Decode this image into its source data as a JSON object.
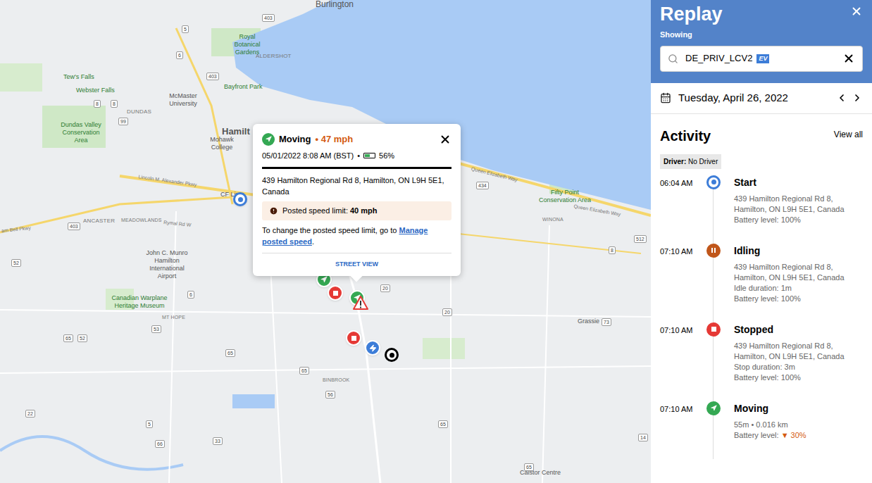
{
  "map": {
    "labels": [
      "Burlington",
      "Royal Botanical Gardens",
      "ALDERSHOT",
      "Tew's Falls",
      "Webster Falls",
      "McMaster University",
      "Bayfront Park",
      "DUNDAS",
      "Dundas Valley Conservation Area",
      "Hamilt",
      "Mohawk College",
      "CF Lime",
      "ANCASTER",
      "MEADOWLANDS",
      "Lincoln M. Alexander Pkwy",
      "Rymal Rd W",
      "am Bell Pkwy",
      "John C. Munro Hamilton International Airport",
      "Canadian Warplane Heritage Museum",
      "MT HOPE",
      "BINBROOK",
      "Fifty Point Conservation Area",
      "WINONA",
      "Queen Elizabeth Way",
      "Queen Elizabeth Way",
      "Grassie",
      "Caistor Centre"
    ],
    "shields": [
      "5",
      "403",
      "6",
      "403",
      "8",
      "8",
      "99",
      "434",
      "512",
      "8",
      "52",
      "6",
      "53",
      "52",
      "65",
      "65",
      "56",
      "65",
      "20",
      "20",
      "73",
      "5",
      "22",
      "33",
      "66",
      "65",
      "14",
      "65",
      "403"
    ],
    "pins": [
      {
        "kind": "start"
      },
      {
        "kind": "moving"
      },
      {
        "kind": "stopped"
      },
      {
        "kind": "moving"
      },
      {
        "kind": "warning"
      },
      {
        "kind": "stopped"
      },
      {
        "kind": "charging"
      },
      {
        "kind": "end"
      }
    ]
  },
  "popup": {
    "status": "Moving",
    "separator": "•",
    "speed": "47 mph",
    "datetime": "05/01/2022 8:08 AM (BST)",
    "battery": {
      "level": 0.56,
      "reading": "56%"
    },
    "address": "439 Hamilton Regional Rd 8, Hamilton, ON L9H 5E1, Canada",
    "limit_label": "Posted speed limit:",
    "limit_value": "40 mph",
    "note": "To change the posted speed limit, go to",
    "link": "Manage posted speed",
    "note_end": ".",
    "street_view": "STREET VIEW"
  },
  "panel": {
    "title": "Replay",
    "showing": "Showing",
    "search": {
      "value": "DE_PRIV_LCV2",
      "badge": "EV"
    },
    "date": "Tuesday, April 26, 2022",
    "activity_title": "Activity",
    "view_all": "View all",
    "driver_label": "Driver:",
    "driver_value": "No Driver",
    "items": [
      {
        "time": "06:04 AM",
        "kind": "start",
        "title": "Start",
        "lines": [
          "439 Hamilton Regional Rd 8, Hamilton, ON L9H 5E1, Canada"
        ],
        "battery": {
          "label": "Battery level:",
          "value": "100%",
          "marker": "",
          "low": false
        }
      },
      {
        "time": "07:10 AM",
        "kind": "idling",
        "title": "Idling",
        "lines": [
          "439 Hamilton Regional Rd 8, Hamilton, ON L9H 5E1, Canada",
          "Idle duration: 1m"
        ],
        "battery": {
          "label": "Battery level:",
          "value": "100%",
          "marker": "",
          "low": false
        }
      },
      {
        "time": "07:10 AM",
        "kind": "stopped",
        "title": "Stopped",
        "lines": [
          "439 Hamilton Regional Rd 8, Hamilton, ON L9H 5E1, Canada",
          "Stop duration: 3m"
        ],
        "battery": {
          "label": "Battery level:",
          "value": "100%",
          "marker": "",
          "low": false
        }
      },
      {
        "time": "07:10 AM",
        "kind": "moving",
        "title": "Moving",
        "lines": [
          "55m • 0.016 km"
        ],
        "battery": {
          "label": "Battery level:",
          "value": "30%",
          "marker": "▼",
          "low": true
        }
      }
    ]
  }
}
